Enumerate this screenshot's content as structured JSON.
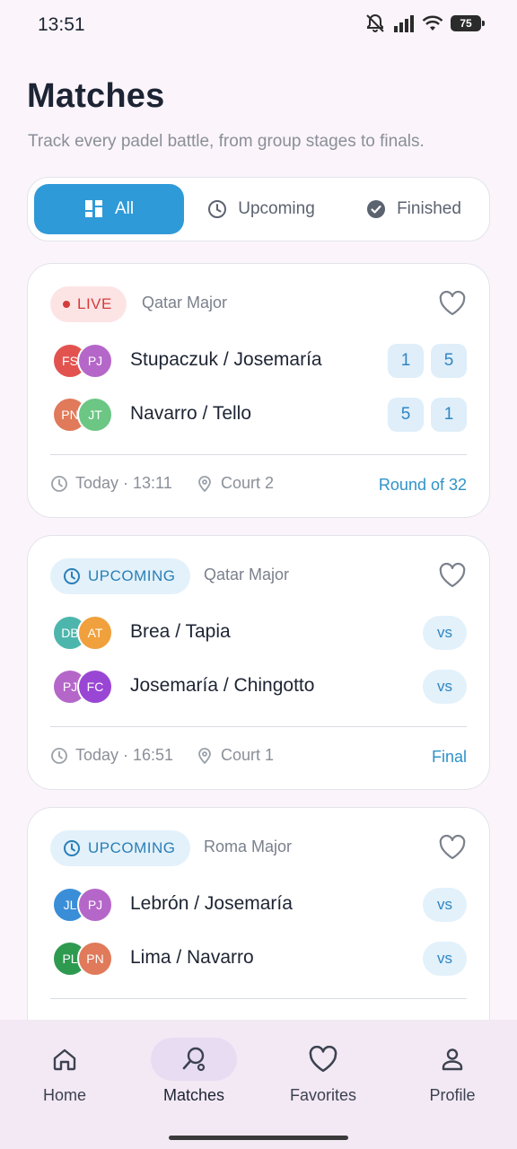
{
  "status_bar": {
    "time": "13:51",
    "battery": "75"
  },
  "header": {
    "title": "Matches",
    "subtitle": "Track every padel battle, from group stages to finals."
  },
  "filters": [
    {
      "label": "All",
      "icon": "grid-icon",
      "active": true
    },
    {
      "label": "Upcoming",
      "icon": "clock-icon",
      "active": false
    },
    {
      "label": "Finished",
      "icon": "check-circle-icon",
      "active": false
    }
  ],
  "matches": [
    {
      "status": "LIVE",
      "tournament": "Qatar Major",
      "team1": {
        "name": "Stupaczuk / Josemaría",
        "initials": [
          "FS",
          "PJ"
        ],
        "colors": [
          "#e2534f",
          "#b567c9"
        ],
        "scores": [
          "1",
          "5"
        ]
      },
      "team2": {
        "name": "Navarro / Tello",
        "initials": [
          "PN",
          "JT"
        ],
        "colors": [
          "#e07a5a",
          "#6cc684"
        ],
        "scores": [
          "5",
          "1"
        ]
      },
      "time": "Today · 13:11",
      "court": "Court 2",
      "round": "Round of 32"
    },
    {
      "status": "UPCOMING",
      "tournament": "Qatar Major",
      "team1": {
        "name": "Brea / Tapia",
        "initials": [
          "DB",
          "AT"
        ],
        "colors": [
          "#4db6ac",
          "#f0a03c"
        ],
        "vs": "vs"
      },
      "team2": {
        "name": "Josemaría / Chingotto",
        "initials": [
          "PJ",
          "FC"
        ],
        "colors": [
          "#b567c9",
          "#9a46d4"
        ],
        "vs": "vs"
      },
      "time": "Today · 16:51",
      "court": "Court 1",
      "round": "Final"
    },
    {
      "status": "UPCOMING",
      "tournament": "Roma Major",
      "team1": {
        "name": "Lebrón / Josemaría",
        "initials": [
          "JL",
          "PJ"
        ],
        "colors": [
          "#3a8ed8",
          "#b567c9"
        ],
        "vs": "vs"
      },
      "team2": {
        "name": "Lima / Navarro",
        "initials": [
          "PL",
          "PN"
        ],
        "colors": [
          "#2e9a50",
          "#e07a5a"
        ],
        "vs": "vs"
      }
    }
  ],
  "bottom_nav": [
    {
      "label": "Home",
      "icon": "home-icon",
      "active": false
    },
    {
      "label": "Matches",
      "icon": "racket-icon",
      "active": true
    },
    {
      "label": "Favorites",
      "icon": "heart-icon",
      "active": false
    },
    {
      "label": "Profile",
      "icon": "person-icon",
      "active": false
    }
  ]
}
